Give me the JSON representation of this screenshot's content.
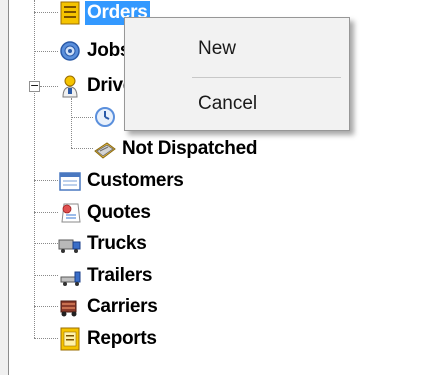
{
  "tree": {
    "items": [
      {
        "label": "Orders",
        "icon": "orders-icon"
      },
      {
        "label": "Jobs",
        "icon": "jobs-icon"
      },
      {
        "label": "Drivers",
        "icon": "drivers-icon"
      },
      {
        "label": "",
        "icon": "dispatched-icon"
      },
      {
        "label": "Not Dispatched",
        "icon": "not-dispatched-icon"
      },
      {
        "label": "Customers",
        "icon": "customers-icon"
      },
      {
        "label": "Quotes",
        "icon": "quotes-icon"
      },
      {
        "label": "Trucks",
        "icon": "trucks-icon"
      },
      {
        "label": "Trailers",
        "icon": "trailers-icon"
      },
      {
        "label": "Carriers",
        "icon": "carriers-icon"
      },
      {
        "label": "Reports",
        "icon": "reports-icon"
      }
    ],
    "expander_symbol": "−",
    "selection_color": "#3399ff"
  },
  "context_menu": {
    "items": [
      {
        "label": "New"
      },
      {
        "label": "Cancel"
      }
    ]
  }
}
